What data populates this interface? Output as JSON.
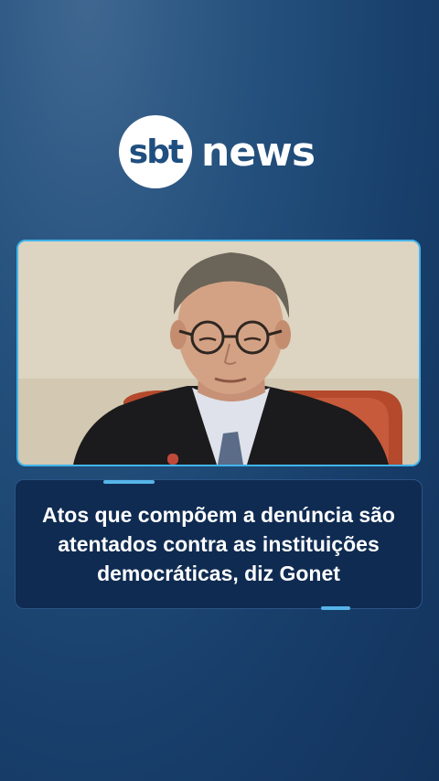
{
  "brand": {
    "logo_mark": "sbt",
    "logo_word": "news"
  },
  "photo": {
    "subject": "man-wearing-glasses-and-black-robe"
  },
  "caption": {
    "headline": "Atos que compõem a denúncia são atentados contra as instituições democráticas, diz Gonet"
  },
  "colors": {
    "background": "#1b4471",
    "caption_background": "#0f2b52",
    "accent": "#56b4e8",
    "logo_text": "#ffffff"
  }
}
